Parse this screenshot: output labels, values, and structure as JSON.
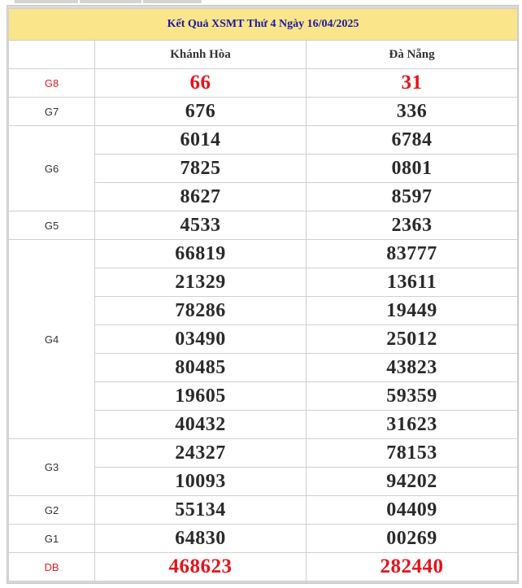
{
  "title": "Kết Quả XSMT Thứ 4 Ngày 16/04/2025",
  "provinces": [
    "Khánh Hòa",
    "Đà Nẵng"
  ],
  "prizes": [
    {
      "label": "G8",
      "khanh_hoa": [
        "66"
      ],
      "da_nang": [
        "31"
      ]
    },
    {
      "label": "G7",
      "khanh_hoa": [
        "676"
      ],
      "da_nang": [
        "336"
      ]
    },
    {
      "label": "G6",
      "khanh_hoa": [
        "6014",
        "7825",
        "8627"
      ],
      "da_nang": [
        "6784",
        "0801",
        "8597"
      ]
    },
    {
      "label": "G5",
      "khanh_hoa": [
        "4533"
      ],
      "da_nang": [
        "2363"
      ]
    },
    {
      "label": "G4",
      "khanh_hoa": [
        "66819",
        "21329",
        "78286",
        "03490",
        "80485",
        "19605",
        "40432"
      ],
      "da_nang": [
        "83777",
        "13611",
        "19449",
        "25012",
        "43823",
        "59359",
        "31623"
      ]
    },
    {
      "label": "G3",
      "khanh_hoa": [
        "24327",
        "10093"
      ],
      "da_nang": [
        "78153",
        "94202"
      ]
    },
    {
      "label": "G2",
      "khanh_hoa": [
        "55134"
      ],
      "da_nang": [
        "04409"
      ]
    },
    {
      "label": "G1",
      "khanh_hoa": [
        "64830"
      ],
      "da_nang": [
        "00269"
      ]
    },
    {
      "label": "DB",
      "khanh_hoa": [
        "468623"
      ],
      "da_nang": [
        "282440"
      ]
    }
  ],
  "colors": {
    "title_bg": "#fbe58a",
    "title_text": "#1a1a9c",
    "highlight": "#e4141b"
  }
}
